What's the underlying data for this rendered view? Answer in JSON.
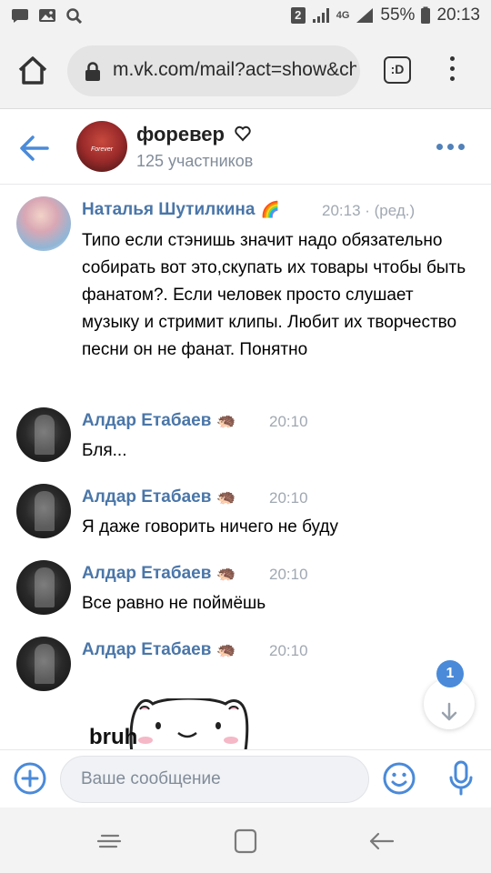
{
  "status_bar": {
    "sim_badge": "2",
    "network": "4G",
    "battery": "55%",
    "time": "20:13"
  },
  "browser": {
    "url": "m.vk.com/mail?act=show&chat",
    "tabs_label": ":D"
  },
  "chat": {
    "title": "форевер",
    "title_icon": "heart-outline",
    "subtitle": "125 участников",
    "avatar_caption": "Forever"
  },
  "messages": [
    {
      "author": "Наталья Шутилкина",
      "author_emoji": "🌈",
      "time": "20:13 · (ред.)",
      "text": "Типо если стэнишь значит надо обязательно собирать вот это,скупать их товары чтобы быть фанатом?. Если человек просто слушает музыку и стримит клипы. Любит их творчество песни он не фанат. Понятно"
    },
    {
      "author": "Алдар Етабаев",
      "author_emoji": "🦔",
      "time": "20:10",
      "text": "Бля..."
    },
    {
      "author": "Алдар Етабаев",
      "author_emoji": "🦔",
      "time": "20:10",
      "text": "Я даже говорить ничего не буду"
    },
    {
      "author": "Алдар Етабаев",
      "author_emoji": "🦔",
      "time": "20:10",
      "text": "Все равно не поймёшь"
    },
    {
      "author": "Алдар Етабаев",
      "author_emoji": "🦔",
      "time": "20:10",
      "text": ""
    }
  ],
  "sticker": {
    "text": "bruh"
  },
  "unread_badge": "1",
  "composer": {
    "placeholder": "Ваше сообщение"
  },
  "colors": {
    "accent": "#4a76a8",
    "author_link": "#4a76a8",
    "muted": "#818c99",
    "badge": "#4a8ad9"
  }
}
